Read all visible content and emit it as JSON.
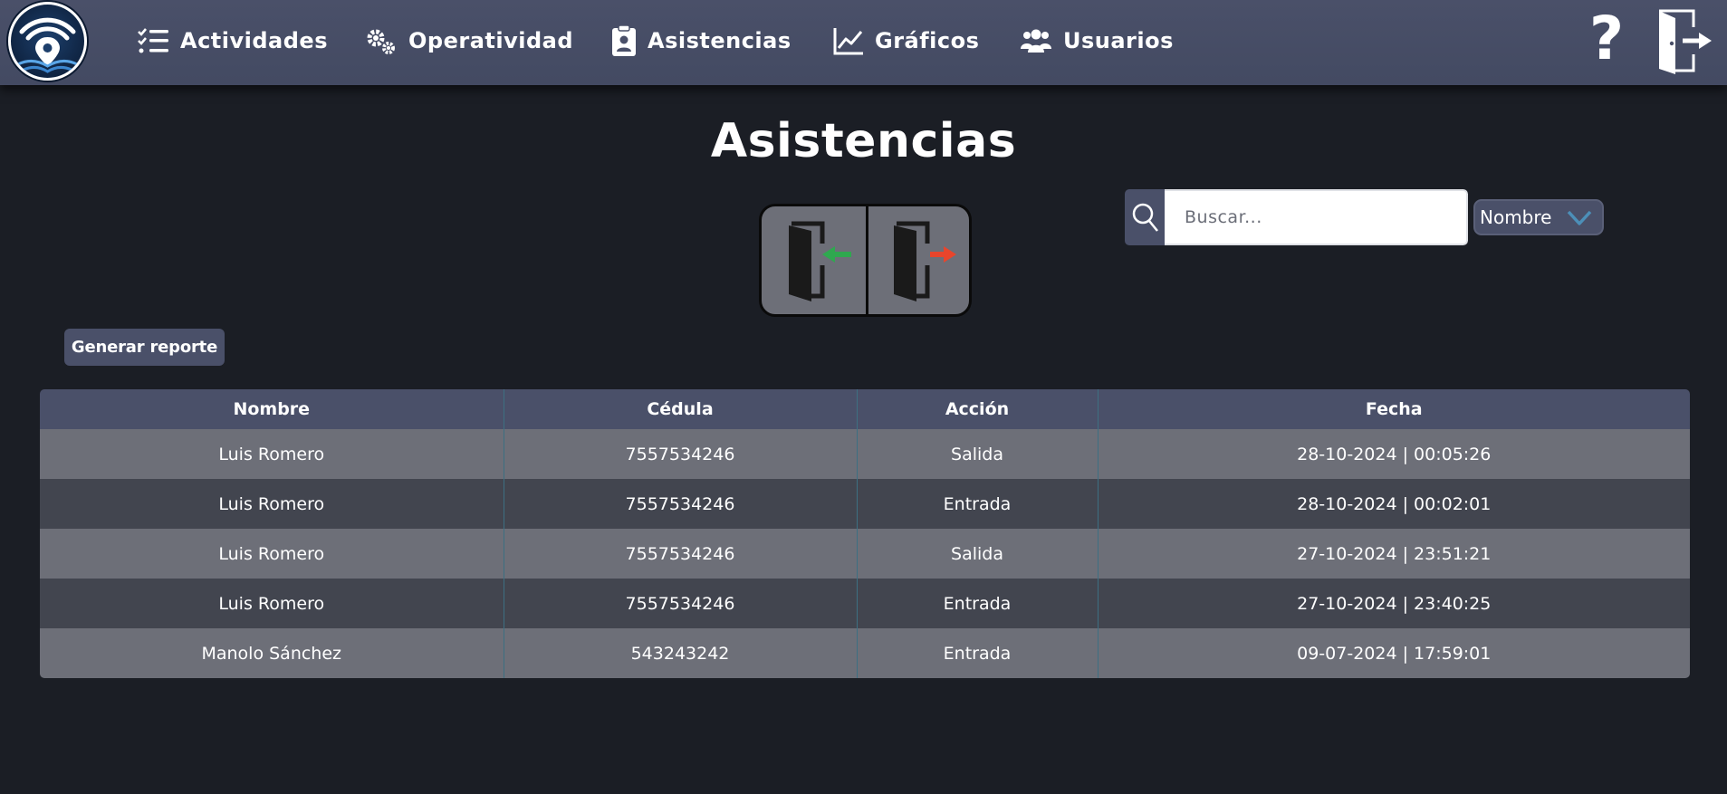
{
  "nav": {
    "items": [
      {
        "label": "Actividades",
        "icon": "task-list-icon"
      },
      {
        "label": "Operatividad",
        "icon": "gears-icon"
      },
      {
        "label": "Asistencias",
        "icon": "clipboard-user-icon"
      },
      {
        "label": "Gráficos",
        "icon": "line-chart-icon"
      },
      {
        "label": "Usuarios",
        "icon": "users-icon"
      }
    ],
    "help_label": "?"
  },
  "page": {
    "title": "Asistencias"
  },
  "search": {
    "placeholder": "Buscar...",
    "filter_selected": "Nombre"
  },
  "report_button": "Generar reporte",
  "table": {
    "columns": [
      "Nombre",
      "Cédula",
      "Acción",
      "Fecha"
    ],
    "rows": [
      [
        "Luis Romero",
        "7557534246",
        "Salida",
        "28-10-2024 | 00:05:26"
      ],
      [
        "Luis Romero",
        "7557534246",
        "Entrada",
        "28-10-2024 | 00:02:01"
      ],
      [
        "Luis Romero",
        "7557534246",
        "Salida",
        "27-10-2024 | 23:51:21"
      ],
      [
        "Luis Romero",
        "7557534246",
        "Entrada",
        "27-10-2024 | 23:40:25"
      ],
      [
        "Manolo Sánchez",
        "543243242",
        "Entrada",
        "09-07-2024 | 17:59:01"
      ]
    ]
  },
  "colors": {
    "background": "#1b1e25",
    "nav_bar": "#4a5069",
    "row_light": "#6d6f78",
    "row_dark": "#42454f",
    "entry_arrow": "#2fa84f",
    "exit_arrow": "#e8452c"
  }
}
